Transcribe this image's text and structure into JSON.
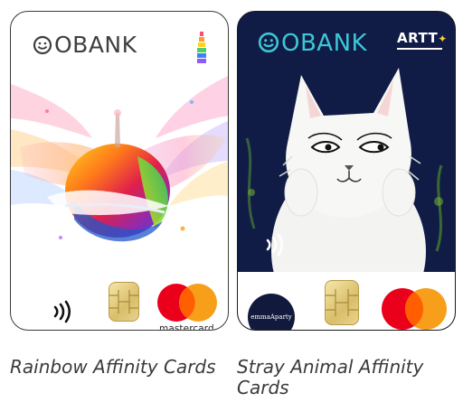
{
  "cards": [
    {
      "brand_logo": "OBANK",
      "contactless_icon": "contactless-icon",
      "network_logo": "mastercard",
      "caption": "Rainbow Affinity Cards"
    },
    {
      "brand_logo": "OBANK",
      "partner_logo": "ARTT",
      "contactless_icon": "contactless-icon",
      "partner_badge": "emmaAparty",
      "network_logo": "mastercard",
      "caption_line1": "Stray Animal Affinity",
      "caption_line2": "Cards"
    }
  ],
  "colors": {
    "card1_bg": "#ffffff",
    "card2_bg": "#101c45",
    "obank_teal": "#3dc6d6",
    "mastercard_red": "#eb001b",
    "mastercard_orange": "#f79e1b",
    "mastercard_overlap": "#ff5f00"
  }
}
